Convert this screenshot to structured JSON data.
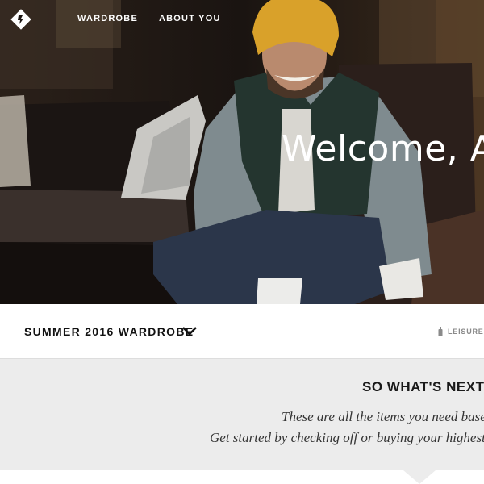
{
  "nav": {
    "logo_icon": "monogram-diamond-icon",
    "items": [
      {
        "label": "WARDROBE"
      },
      {
        "label": "ABOUT YOU"
      }
    ]
  },
  "hero": {
    "welcome": "Welcome, An"
  },
  "wardrobe_bar": {
    "selector_label": "SUMMER 2016 WARDROBE",
    "chevron_icon": "chevron-down-icon",
    "leisure_icon": "bottle-icon",
    "leisure_label": "LEISURE"
  },
  "next_section": {
    "title": "SO WHAT'S NEXT?",
    "line1": "These are all the items you need based o",
    "line2": "Get started by checking off or buying your highest pri"
  },
  "colors": {
    "hero_text": "#ffffff",
    "panel_bg": "#ececec",
    "bar_bg": "#ffffff",
    "muted": "#8a8a8a"
  }
}
